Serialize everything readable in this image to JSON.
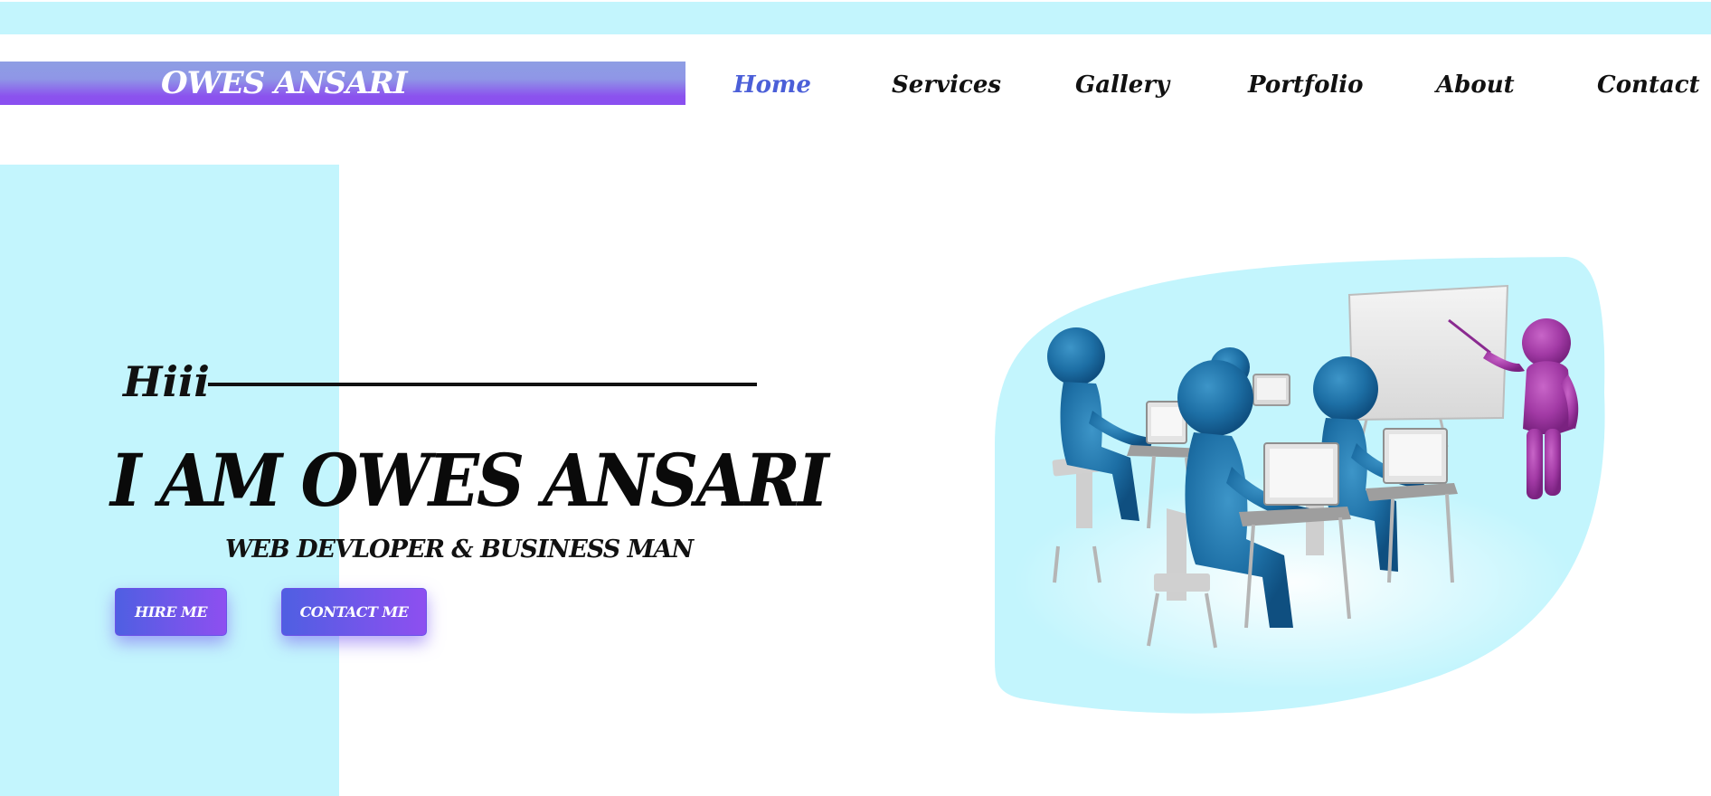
{
  "header": {
    "logo": "OWES ANSARI",
    "nav": [
      {
        "label": "Home",
        "active": true
      },
      {
        "label": "Services",
        "active": false
      },
      {
        "label": "Gallery",
        "active": false
      },
      {
        "label": "Portfolio",
        "active": false
      },
      {
        "label": "About",
        "active": false
      },
      {
        "label": "Contact",
        "active": false
      }
    ]
  },
  "hero": {
    "greeting": "Hiii",
    "headline": "I AM OWES ANSARI",
    "subline": "WEB DEVLOPER & BUSINESS MAN",
    "buttons": {
      "hire": "HIRE ME",
      "contact": "CONTACT ME"
    }
  },
  "colors": {
    "accent_cyan": "#c3f5fd",
    "gradient_start": "#4f5fe2",
    "gradient_end": "#8e4ff0",
    "nav_active": "#4b5fd8",
    "figure_blue": "#1d6fa5",
    "presenter_purple": "#a23aa5"
  },
  "illustration": {
    "subject": "3d-classroom-figures-with-laptops-and-presenter-at-whiteboard"
  }
}
